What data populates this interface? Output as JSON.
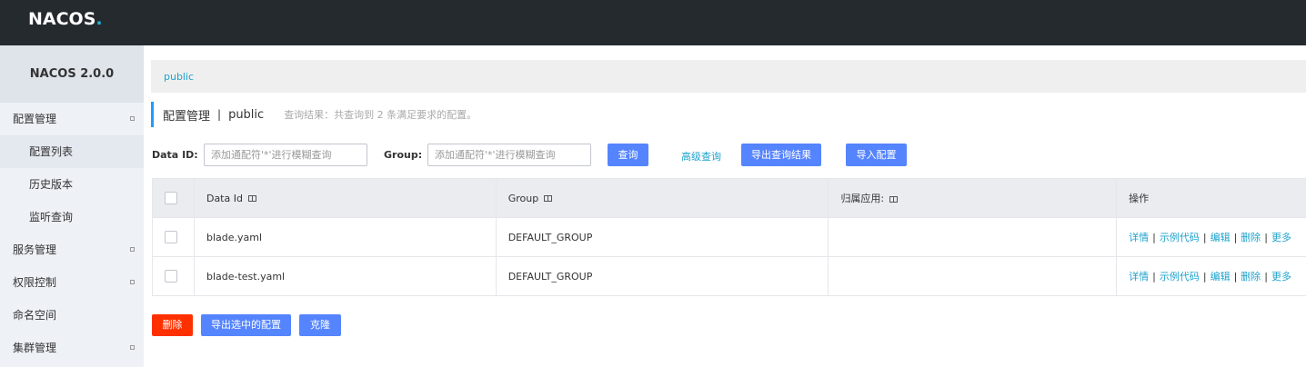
{
  "header": {
    "logo_text": "NACOS",
    "logo_dot": "."
  },
  "sidebar": {
    "version": "NACOS 2.0.0",
    "items": [
      {
        "label": "配置管理"
      },
      {
        "label": "配置列表"
      },
      {
        "label": "历史版本"
      },
      {
        "label": "监听查询"
      },
      {
        "label": "服务管理"
      },
      {
        "label": "权限控制"
      },
      {
        "label": "命名空间"
      },
      {
        "label": "集群管理"
      }
    ]
  },
  "namespace_bar": {
    "current": "public"
  },
  "title": {
    "main": "配置管理",
    "separator": "|",
    "namespace": "public",
    "result": "查询结果：共查询到 2 条满足要求的配置。"
  },
  "search": {
    "data_id_label": "Data ID:",
    "data_id_placeholder": "添加通配符'*'进行模糊查询",
    "group_label": "Group:",
    "group_placeholder": "添加通配符'*'进行模糊查询",
    "query_button": "查询",
    "advanced_link": "高级查询",
    "export_button": "导出查询结果",
    "import_button": "导入配置"
  },
  "table": {
    "columns": [
      "Data Id",
      "Group",
      "归属应用:",
      "操作"
    ],
    "rows": [
      {
        "data_id": "blade.yaml",
        "group": "DEFAULT_GROUP",
        "app": ""
      },
      {
        "data_id": "blade-test.yaml",
        "group": "DEFAULT_GROUP",
        "app": ""
      }
    ],
    "ops": [
      "详情",
      "示例代码",
      "编辑",
      "删除",
      "更多"
    ]
  },
  "bottom": {
    "delete_button": "删除",
    "export_selected_button": "导出选中的配置",
    "clone_button": "克隆"
  },
  "colors": {
    "primary": "#5584ff",
    "danger": "#ff3000",
    "link": "#1fa3cc",
    "topbar": "#252a2f"
  }
}
